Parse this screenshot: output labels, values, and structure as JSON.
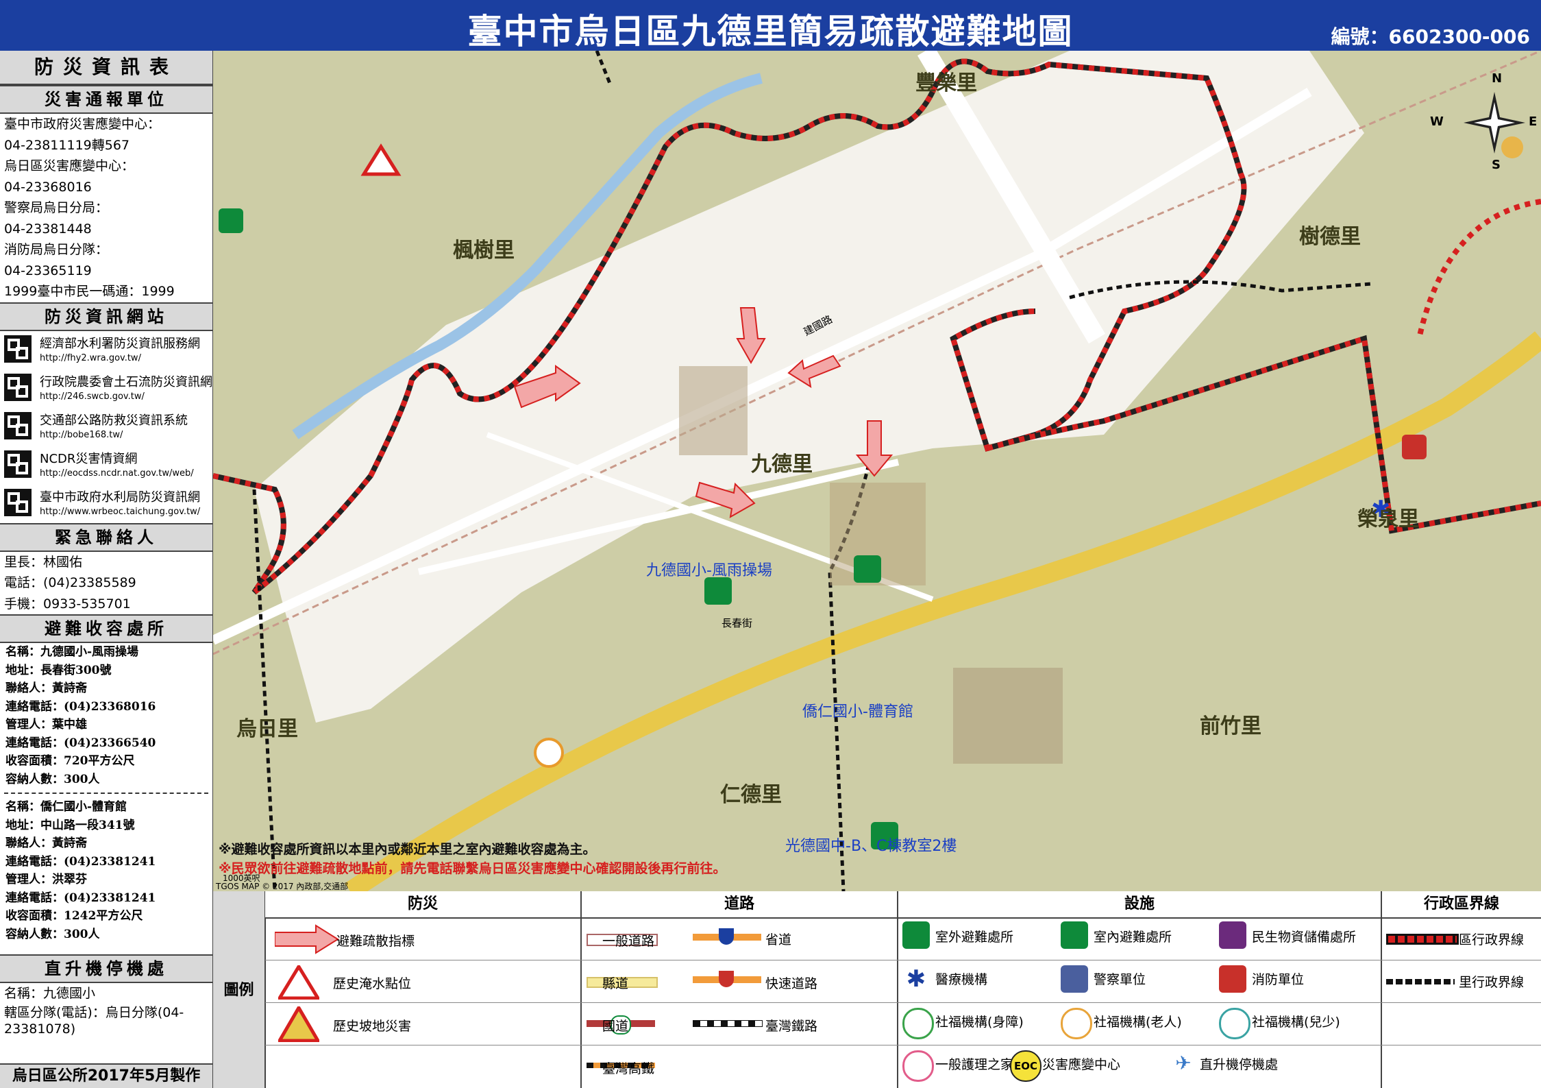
{
  "header": {
    "title": "臺中市烏日區九德里簡易疏散避難地圖",
    "code": "編號：6602300-006"
  },
  "sidebar": {
    "info_title": "防災資訊表",
    "report_title": "災害通報單位",
    "report_lines": [
      "臺中市政府災害應變中心：",
      "04-23811119轉567",
      "烏日區災害應變中心：",
      "04-23368016",
      "警察局烏日分局：",
      "04-23381448",
      "消防局烏日分隊：",
      "04-23365119",
      "1999臺中市民一碼通：1999"
    ],
    "web_title": "防災資訊網站",
    "websites": [
      {
        "name": "經濟部水利署防災資訊服務網",
        "url": "http://fhy2.wra.gov.tw/"
      },
      {
        "name": "行政院農委會土石流防災資訊網",
        "url": "http://246.swcb.gov.tw/"
      },
      {
        "name": "交通部公路防救災資訊系統",
        "url": "http://bobe168.tw/"
      },
      {
        "name": "NCDR災害情資網",
        "url": "http://eocdss.ncdr.nat.gov.tw/web/"
      },
      {
        "name": "臺中市政府水利局防災資訊網",
        "url": "http://www.wrbeoc.taichung.gov.tw/"
      }
    ],
    "contact_title": "緊急聯絡人",
    "contact_lines": [
      "里長：林國佑",
      "電話：(04)23385589",
      "手機：0933-535701"
    ],
    "shelter_title": "避難收容處所",
    "shelter1": [
      "名稱：九德國小-風雨操場",
      "地址：長春街300號",
      "聯絡人：黃詩斋",
      "連絡電話：(04)23368016",
      "管理人：葉中雄",
      "連絡電話：(04)23366540",
      "收容面積：720平方公尺",
      "容納人數：300人"
    ],
    "shelter2": [
      "名稱：僑仁國小-體育館",
      "地址：中山路一段341號",
      "聯絡人：黃詩斋",
      "連絡電話：(04)23381241",
      "管理人：洪翠芬",
      "連絡電話：(04)23381241",
      "收容面積：1242平方公尺",
      "容納人數：300人"
    ],
    "heli_title": "直升機停機處",
    "heli_lines": [
      "名稱：九德國小",
      "轄區分隊(電話)：烏日分隊(04-23381078)"
    ],
    "footer": "烏日區公所2017年5月製作"
  },
  "map": {
    "villages": [
      "豐樂里",
      "楓樹里",
      "樹德里",
      "九德里",
      "烏日里",
      "前竹里",
      "仁德里",
      "榮泉里"
    ],
    "village_rong": "榮泉里",
    "shelter_labels": [
      "九德國小-風雨操場",
      "僑仁國小-體育館",
      "光德國中-B、C棟教室2樓"
    ],
    "road_labels": [
      "建國路",
      "長春街"
    ],
    "compass": [
      "N",
      "S",
      "W",
      "E"
    ],
    "note1": "※避難收容處所資訊以本里內或鄰近本里之室內避難收容處為主。",
    "note2": "※民眾欲前往避難疏散地點前，請先電話聯繫烏日區災害應變中心確認開設後再行前往。",
    "scale": "1000英呎",
    "credit": "TGOS MAP © 2017 內政部,交通部"
  },
  "legend": {
    "label": "圖例",
    "heads": [
      "防災",
      "道路",
      "設施",
      "行政區界線"
    ],
    "disaster": [
      "避難疏散指標",
      "歷史淹水點位",
      "歷史坡地災害"
    ],
    "roads": [
      "一般道路",
      "省道",
      "縣道",
      "快速道路",
      "國道",
      "臺灣鐵路",
      "臺灣高鐵"
    ],
    "facilities": [
      "室外避難處所",
      "室內避難處所",
      "民生物資儲備處所",
      "醫療機構",
      "警察單位",
      "消防單位",
      "社福機構(身障)",
      "社福機構(老人)",
      "社福機構(兒少)",
      "一般護理之家",
      "災害應變中心",
      "直升機停機處"
    ],
    "eoc": "EOC",
    "boundaries": [
      "區行政界線",
      "里行政界線"
    ],
    "colors": {
      "boundary_red": "#d6201f",
      "highway_yellow": "#e8c84a",
      "road_white": "#ffffff",
      "base": "#cdcda6",
      "shelter_green": "#0e8a3a"
    }
  }
}
